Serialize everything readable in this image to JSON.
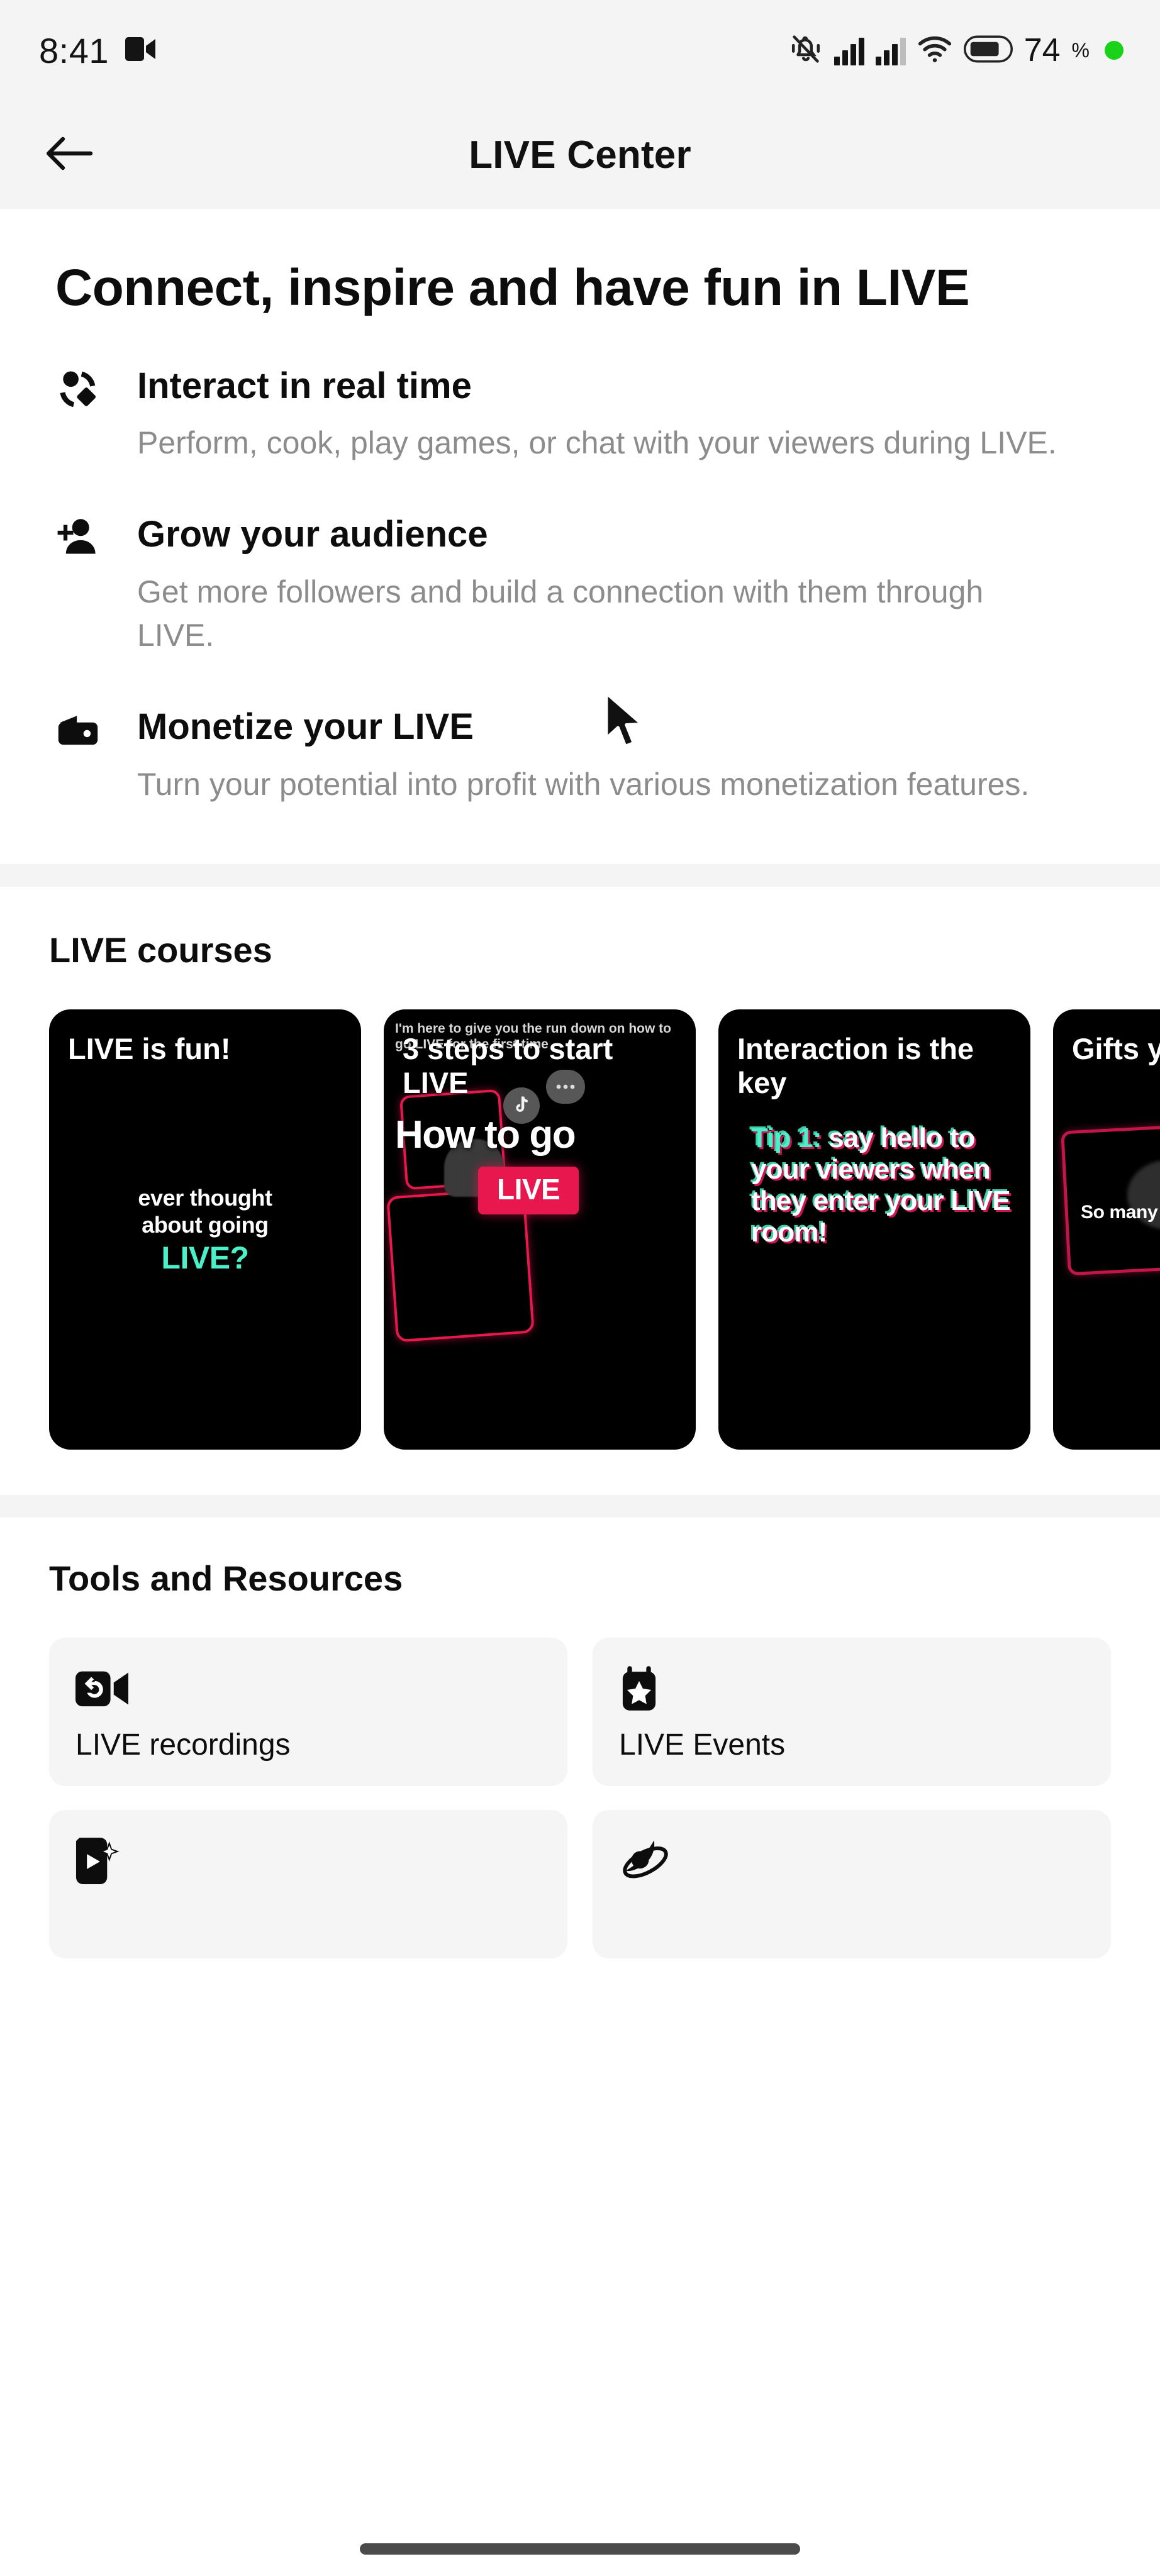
{
  "status_bar": {
    "time": "8:41",
    "camera_icon": "video-camera-icon",
    "mute_icon": "bell-muted-icon",
    "signal1_icon": "cellular-signal-icon",
    "signal2_icon": "cellular-signal-secondary-icon",
    "wifi_icon": "wifi-icon",
    "battery_icon": "battery-icon",
    "battery_level": "74",
    "battery_pct_symbol": "%",
    "recording_dot": "green-recording-dot"
  },
  "navbar": {
    "back_icon": "arrow-left-icon",
    "title": "LIVE Center"
  },
  "hero": {
    "heading": "Connect, inspire and have fun in LIVE"
  },
  "features": [
    {
      "icon": "interact-realtime-icon",
      "title": "Interact in real time",
      "desc": "Perform, cook, play games, or chat with your viewers during LIVE."
    },
    {
      "icon": "person-add-icon",
      "title": "Grow your audience",
      "desc": "Get more followers and build a connection with them through LIVE."
    },
    {
      "icon": "wallet-icon",
      "title": "Monetize your LIVE",
      "desc": "Turn your potential into profit with various monetization features."
    }
  ],
  "courses": {
    "section_title": "LIVE courses",
    "cards": [
      {
        "title": "LIVE is fun!",
        "art_line1": "ever thought",
        "art_line2": "about going",
        "art_line3": "LIVE?"
      },
      {
        "title": "3 steps to start LIVE",
        "caption": "I'm here to give you the run down on how to go LIVE for the first time",
        "big_text": "How to go",
        "chip": "LIVE",
        "tiktok_icon": "tiktok-note-icon",
        "message_icon": "message-bubble-icon"
      },
      {
        "title": "Interaction is the key",
        "tip_label": "Tip 1:",
        "tip_text": "say hello to your viewers when they enter your LIVE room!"
      },
      {
        "title": "Gifts your",
        "art_text": "So many"
      }
    ]
  },
  "tools": {
    "section_title": "Tools and Resources",
    "cards": [
      {
        "icon": "live-recordings-icon",
        "label": "LIVE recordings"
      },
      {
        "icon": "live-events-icon",
        "label": "LIVE Events"
      },
      {
        "icon": "live-effects-icon",
        "label": ""
      },
      {
        "icon": "live-planet-icon",
        "label": ""
      }
    ]
  },
  "colors": {
    "accent_pink": "#e8184f",
    "accent_teal": "#4af0c8",
    "background": "#ffffff",
    "surface": "#f5f5f5",
    "text_primary": "#0d0d0d",
    "text_secondary": "#8c8c8c",
    "status_green": "#19d219"
  },
  "cursor": {
    "icon": "mouse-pointer-icon"
  }
}
